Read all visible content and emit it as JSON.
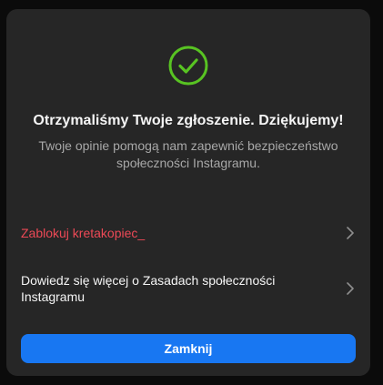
{
  "dialog": {
    "success_icon": "check-circle-icon",
    "accent_color": "#58c322",
    "title": "Otrzymaliśmy Twoje zgłoszenie. Dziękujemy!",
    "subtitle": "Twoje opinie pomogą nam zapewnić bezpieczeństwo społeczności Instagramu.",
    "actions": [
      {
        "label": "Zablokuj kretakopiec_",
        "color": "#ed4956",
        "icon": "chevron-right-icon"
      },
      {
        "label": "Dowiedz się więcej o Zasadach społeczności Instagramu",
        "color": "#f5f5f5",
        "icon": "chevron-right-icon"
      }
    ],
    "close_label": "Zamknij",
    "close_color": "#1877f2"
  }
}
